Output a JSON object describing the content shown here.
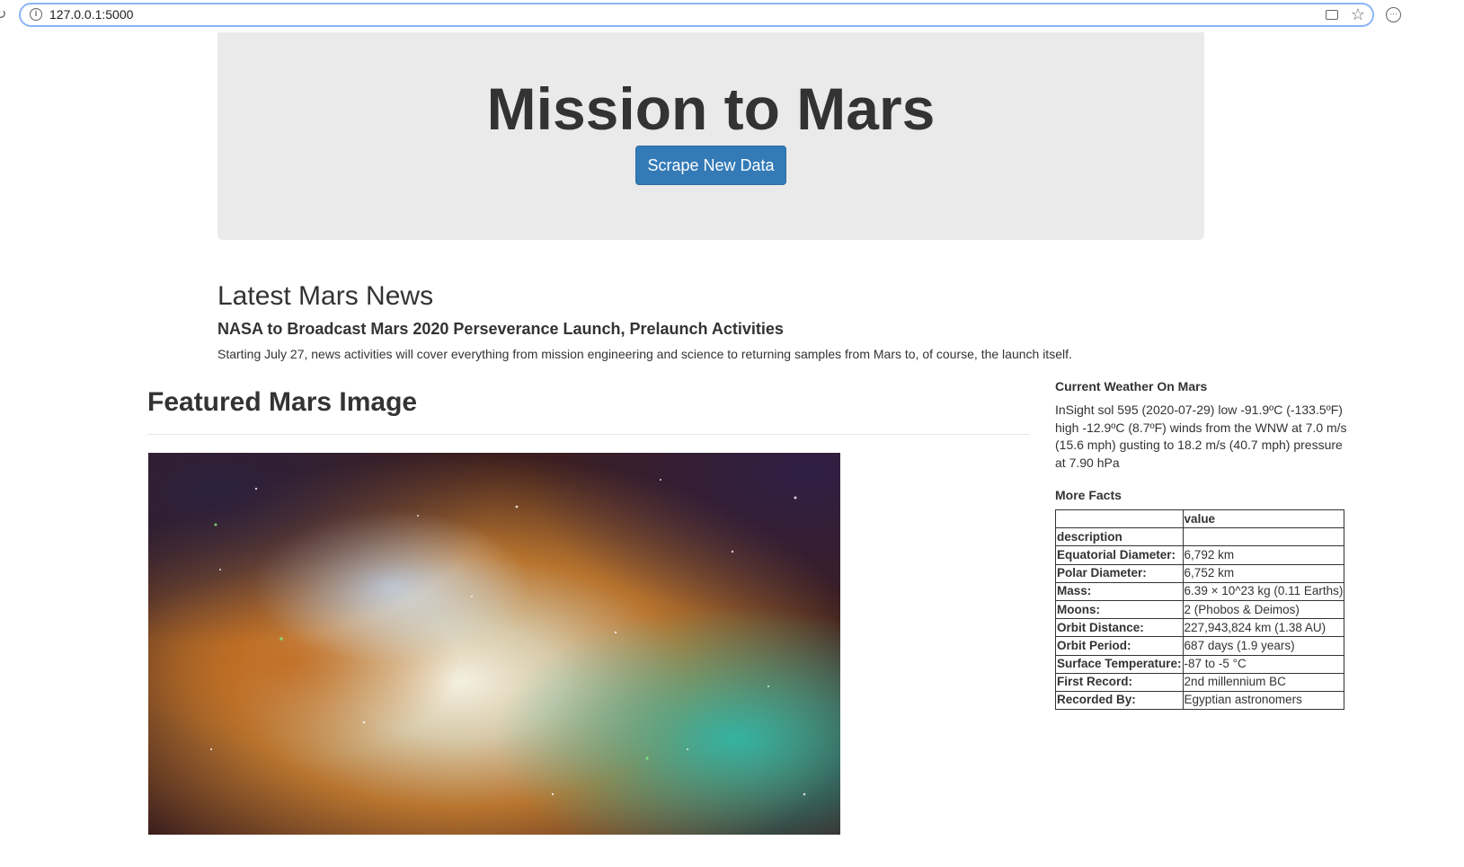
{
  "browser": {
    "url": "127.0.0.1:5000",
    "icons": [
      "reload-icon",
      "info-icon",
      "cast-icon",
      "star-icon",
      "extension-icon"
    ]
  },
  "jumbotron": {
    "title": "Mission to Mars",
    "button_label": "Scrape New Data",
    "button_color": "#337ab7"
  },
  "news": {
    "heading": "Latest Mars News",
    "title": "NASA to Broadcast Mars 2020 Perseverance Launch, Prelaunch Activities",
    "paragraph": "Starting July 27, news activities will cover everything from mission engineering and science to returning samples from Mars to, of course, the launch itself."
  },
  "featured": {
    "heading": "Featured Mars Image"
  },
  "weather": {
    "heading": "Current Weather On Mars",
    "text": "InSight sol 595 (2020-07-29) low -91.9ºC (-133.5ºF) high -12.9ºC (8.7ºF) winds from the WNW at 7.0 m/s (15.6 mph) gusting to 18.2 m/s (40.7 mph) pressure at 7.90 hPa"
  },
  "facts": {
    "heading": "More Facts",
    "header_value": "value",
    "header_index": "description",
    "rows": [
      {
        "label": "Equatorial Diameter:",
        "value": "6,792 km"
      },
      {
        "label": "Polar Diameter:",
        "value": "6,752 km"
      },
      {
        "label": "Mass:",
        "value": "6.39 × 10^23 kg (0.11 Earths)"
      },
      {
        "label": "Moons:",
        "value": "2 (Phobos & Deimos)"
      },
      {
        "label": "Orbit Distance:",
        "value": "227,943,824 km (1.38 AU)"
      },
      {
        "label": "Orbit Period:",
        "value": "687 days (1.9 years)"
      },
      {
        "label": "Surface Temperature:",
        "value": "-87 to -5 °C"
      },
      {
        "label": "First Record:",
        "value": "2nd millennium BC"
      },
      {
        "label": "Recorded By:",
        "value": "Egyptian astronomers"
      }
    ]
  }
}
